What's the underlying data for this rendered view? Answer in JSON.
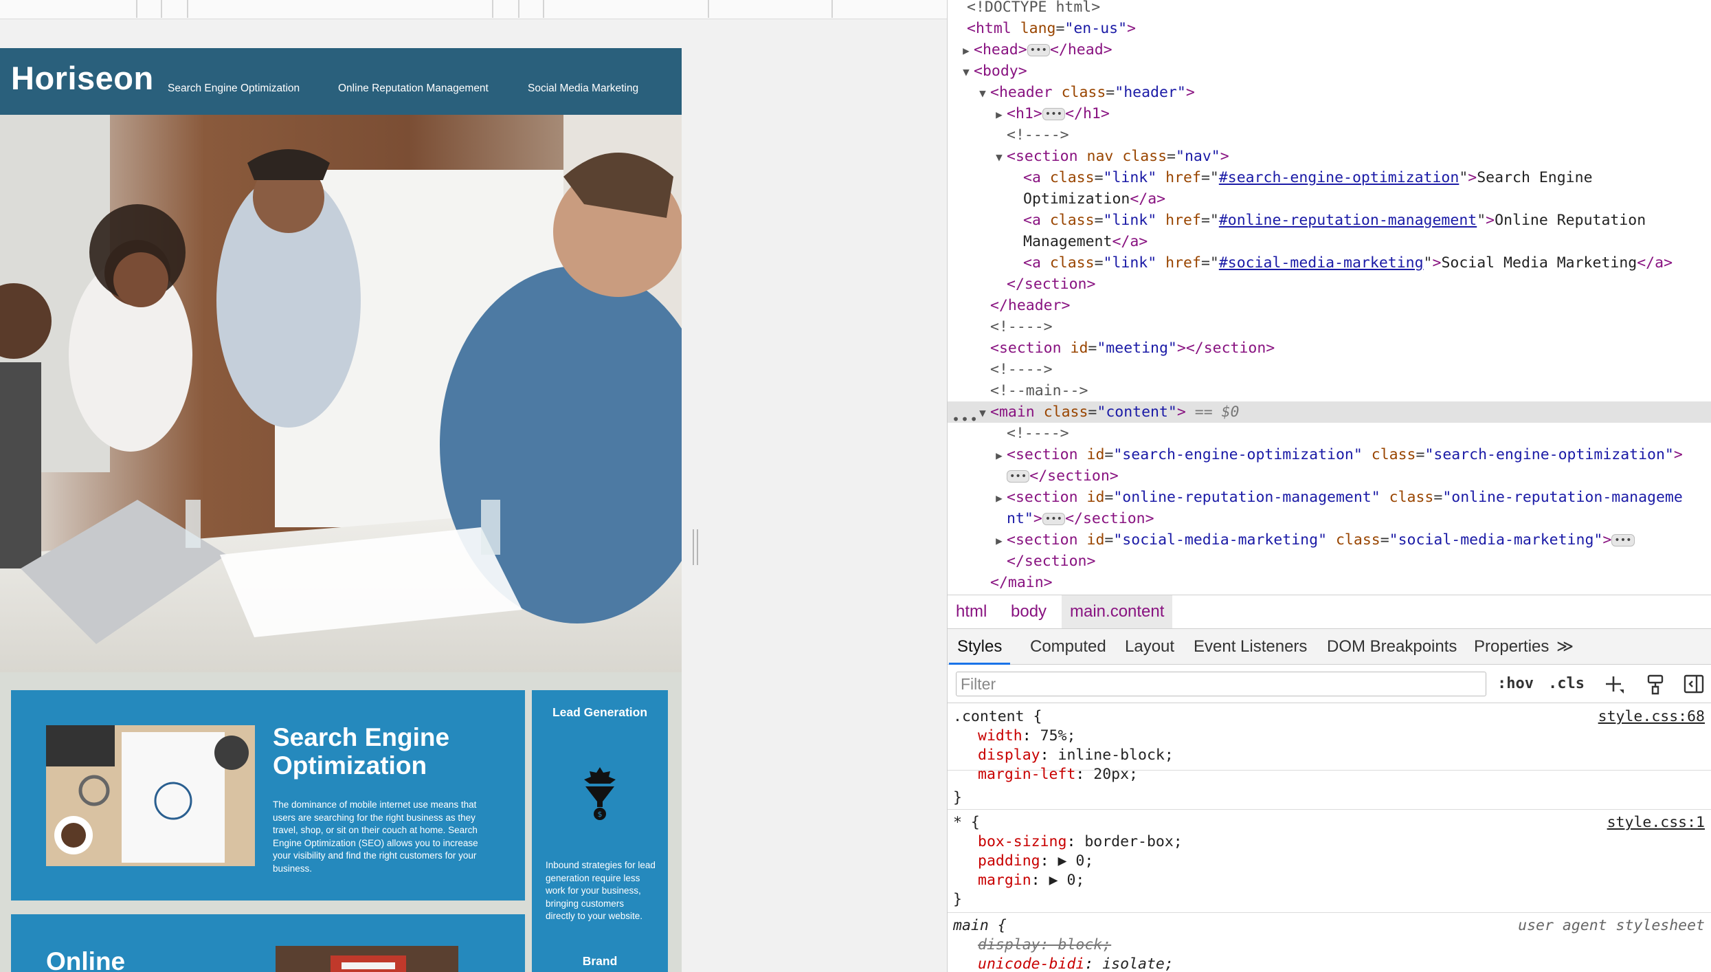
{
  "site": {
    "logo": "Horiseon",
    "nav": [
      "Search Engine Optimization",
      "Online Reputation Management",
      "Social Media Marketing"
    ],
    "seo": {
      "title": "Search Engine Optimization",
      "body": "The dominance of mobile internet use means that users are searching for the right business as they travel, shop, or sit on their couch at home. Search Engine Optimization (SEO) allows you to increase your visibility and find the right customers for your business."
    },
    "lead": {
      "title": "Lead Generation",
      "body": "Inbound strategies for lead generation require less work for your business, bringing customers directly to your website."
    },
    "brand_title": "Brand",
    "orm_title": "Online"
  },
  "devtools": {
    "dom": {
      "doctype": "<!DOCTYPE html>",
      "html_open": "<html",
      "lang_attr": "lang",
      "lang_val": "\"en-us\"",
      "head": "<head>",
      "head_close": "</head>",
      "body": "<body>",
      "header_open": "<header",
      "class_attr": "class",
      "header_class": "\"header\"",
      "h1_open": "<h1>",
      "h1_close": "</h1>",
      "comment_empty": "<!---->",
      "section_open": "<section",
      "nav_attr": "nav",
      "nav_class": "\"nav\"",
      "a_open": "<a",
      "href_attr": "href",
      "link_class": "\"link\"",
      "href_seo": "#search-engine-optimization",
      "href_orm": "#online-reputation-management",
      "href_smm": "#social-media-marketing",
      "text_seo_1": "Search Engine",
      "text_seo_2": "Optimization",
      "text_orm_1": "Online Reputation",
      "text_orm_2": "Management",
      "text_smm": "Social Media Marketing",
      "a_close": "</a>",
      "section_close": "</section>",
      "header_close": "</header>",
      "id_attr": "id",
      "meeting_id": "\"meeting\"",
      "main_comment": "<!--main-->",
      "main_open": "<main",
      "main_class": "\"content\"",
      "selected_marker": "== $0",
      "sec1_id": "\"search-engine-optimization\"",
      "sec1_class": "\"search-engine-optimization\"",
      "sec2_id": "\"online-reputation-management\"",
      "sec2_class_a": "\"online-reputation-manageme",
      "sec2_class_b": "nt\"",
      "sec3_id": "\"social-media-marketing\"",
      "sec3_class": "\"social-media-marketing\"",
      "main_close": "</main>"
    },
    "breadcrumb": [
      "html",
      "body",
      "main.content"
    ],
    "tabs": [
      "Styles",
      "Computed",
      "Layout",
      "Event Listeners",
      "DOM Breakpoints",
      "Properties"
    ],
    "more_tabs_glyph": "≫",
    "filter_placeholder": "Filter",
    "hov": ":hov",
    "cls": ".cls",
    "rules": [
      {
        "selector": ".content {",
        "source": "style.css:68",
        "props": [
          {
            "name": "width",
            "value": "75%;"
          },
          {
            "name": "display",
            "value": "inline-block;"
          },
          {
            "name": "margin-left",
            "value": "20px;"
          }
        ]
      },
      {
        "selector": "* {",
        "source": "style.css:1",
        "props": [
          {
            "name": "box-sizing",
            "value": "border-box;"
          },
          {
            "name": "padding",
            "value": "▶ 0;"
          },
          {
            "name": "margin",
            "value": "▶ 0;"
          }
        ]
      },
      {
        "selector": "main {",
        "source": "user agent stylesheet",
        "props": [
          {
            "name": "display",
            "value": "block;"
          },
          {
            "name": "unicode-bidi",
            "value": "isolate;"
          }
        ]
      }
    ],
    "close_brace": "}"
  },
  "colors": {
    "header": "#2a607c",
    "card": "#2589bd",
    "page_bg": "#d9dcd6"
  }
}
